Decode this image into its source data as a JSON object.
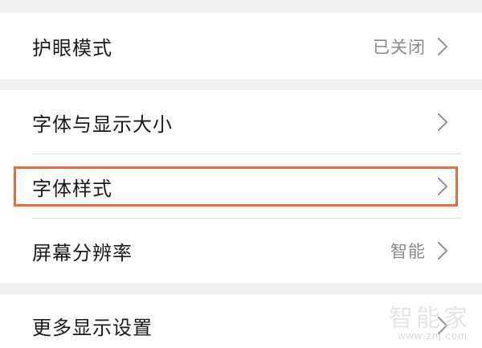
{
  "settings": {
    "items": [
      {
        "label": "护眼模式",
        "value": "已关闭"
      },
      {
        "label": "字体与显示大小",
        "value": ""
      },
      {
        "label": "字体样式",
        "value": ""
      },
      {
        "label": "屏幕分辨率",
        "value": "智能"
      },
      {
        "label": "更多显示设置",
        "value": ""
      }
    ],
    "highlighted_index": 2
  },
  "colors": {
    "background": "#f0f0f0",
    "card": "#ffffff",
    "highlight_border": "#ee6a3a",
    "label_text": "#1a1a1a",
    "value_text": "#8a8a8a",
    "chevron": "#9a9a9a"
  },
  "icons": {
    "chevron": "chevron-right-icon"
  },
  "watermark": {
    "text": "智能家",
    "url": "www.znj.com"
  }
}
